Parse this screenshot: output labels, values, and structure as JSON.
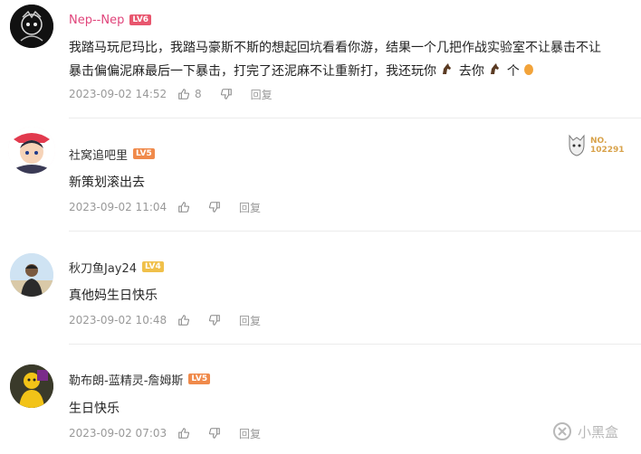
{
  "comments": [
    {
      "username": "Nep--Nep",
      "level": "LV6",
      "text_line1": "我踏马玩尼玛比，我踏马豪斯不斯的想起回坑看看你游，结果一个几把作战实验室不让暴击不让",
      "text_line2_parts": [
        "暴击偏偏泥麻最后一下暴击，打完了还泥麻不让重新打，我还玩你",
        "去你",
        "个"
      ],
      "time": "2023-09-02 14:52",
      "likes": "8",
      "reply": "回复"
    },
    {
      "username": "社窝追吧里",
      "level": "LV5",
      "badge_title": "NO.",
      "badge_number": "102291",
      "text": "新策划滚出去",
      "time": "2023-09-02 11:04",
      "reply": "回复"
    },
    {
      "username": "秋刀鱼Jay24",
      "level": "LV4",
      "text": "真他妈生日快乐",
      "time": "2023-09-02 10:48",
      "reply": "回复"
    },
    {
      "username": "勒布朗-蓝精灵-詹姆斯",
      "level": "LV5",
      "text": "生日快乐",
      "time": "2023-09-02 07:03",
      "reply": "回复"
    }
  ],
  "watermark": "小黑盒",
  "colors": {
    "vip_name": "#e0457b",
    "meta_gray": "#999999",
    "lv6": "#e8566e",
    "lv5": "#f08a4b",
    "lv4": "#f0c04a"
  }
}
